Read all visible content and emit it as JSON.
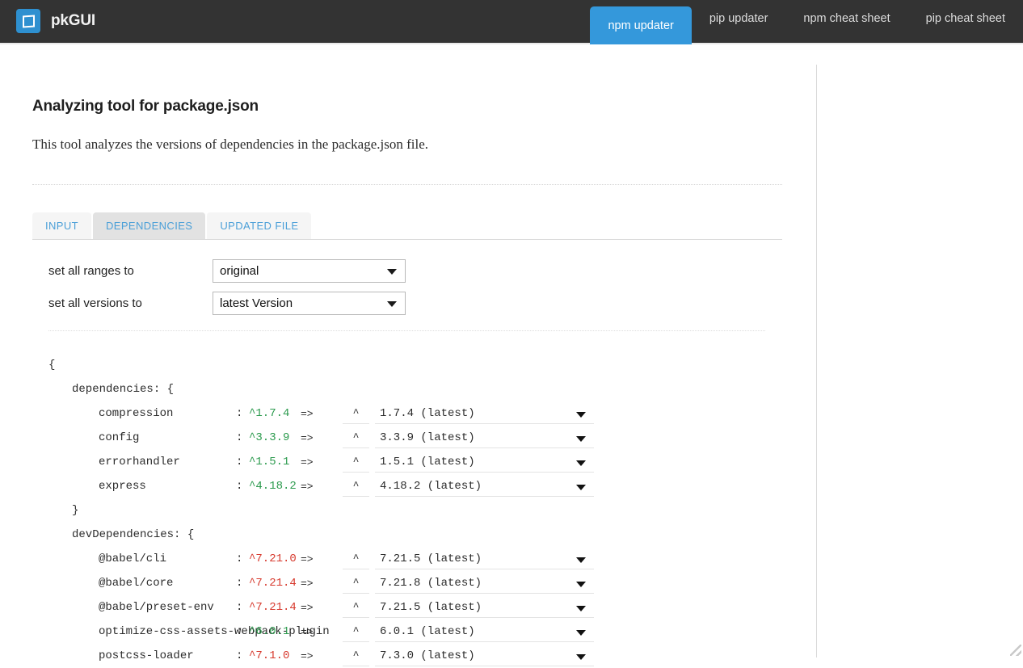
{
  "navbar": {
    "brand": "pkGUI",
    "logo_icon": "app-logo-icon",
    "tabs": [
      {
        "label": "npm updater",
        "active": true
      },
      {
        "label": "pip updater",
        "active": false
      },
      {
        "label": "npm cheat sheet",
        "active": false
      },
      {
        "label": "pip cheat sheet",
        "active": false
      }
    ]
  },
  "main": {
    "title": "Analyzing tool for package.json",
    "description": "This tool analyzes the versions of dependencies in the package.json file.",
    "subtabs": [
      {
        "label": "INPUT",
        "active": false
      },
      {
        "label": "DEPENDENCIES",
        "active": true
      },
      {
        "label": "UPDATED FILE",
        "active": false
      }
    ],
    "settings": [
      {
        "label": "set all ranges to",
        "value": "original"
      },
      {
        "label": "set all versions to",
        "value": "latest Version"
      }
    ]
  },
  "tree": {
    "open_brace": "{",
    "close_brace": "}",
    "dependencies_label": "dependencies: {",
    "devdependencies_label": "devDependencies: {",
    "colon": ":",
    "arrow": "=>",
    "range_symbol": "^"
  },
  "colors": {
    "brand_blue": "#3498db",
    "navbar_bg": "#333333",
    "up_to_date": "#2b9a4d",
    "outdated": "#d73a2e",
    "subtab_link": "#4a9fd8"
  },
  "dependencies": [
    {
      "name": "compression",
      "current": "^1.7.4",
      "outdated": false,
      "range": "^",
      "target": "1.7.4 (latest)"
    },
    {
      "name": "config",
      "current": "^3.3.9",
      "outdated": false,
      "range": "^",
      "target": "3.3.9 (latest)"
    },
    {
      "name": "errorhandler",
      "current": "^1.5.1",
      "outdated": false,
      "range": "^",
      "target": "1.5.1 (latest)"
    },
    {
      "name": "express",
      "current": "^4.18.2",
      "outdated": false,
      "range": "^",
      "target": "4.18.2 (latest)"
    }
  ],
  "devDependencies": [
    {
      "name": "@babel/cli",
      "current": "^7.21.0",
      "outdated": true,
      "range": "^",
      "target": "7.21.5 (latest)"
    },
    {
      "name": "@babel/core",
      "current": "^7.21.4",
      "outdated": true,
      "range": "^",
      "target": "7.21.8 (latest)"
    },
    {
      "name": "@babel/preset-env",
      "current": "^7.21.4",
      "outdated": true,
      "range": "^",
      "target": "7.21.5 (latest)"
    },
    {
      "name": "optimize-css-assets-webpack-plugin",
      "current": "^6.0.1",
      "outdated": false,
      "range": "^",
      "target": "6.0.1 (latest)"
    },
    {
      "name": "postcss-loader",
      "current": "^7.1.0",
      "outdated": true,
      "range": "^",
      "target": "7.3.0 (latest)"
    }
  ]
}
